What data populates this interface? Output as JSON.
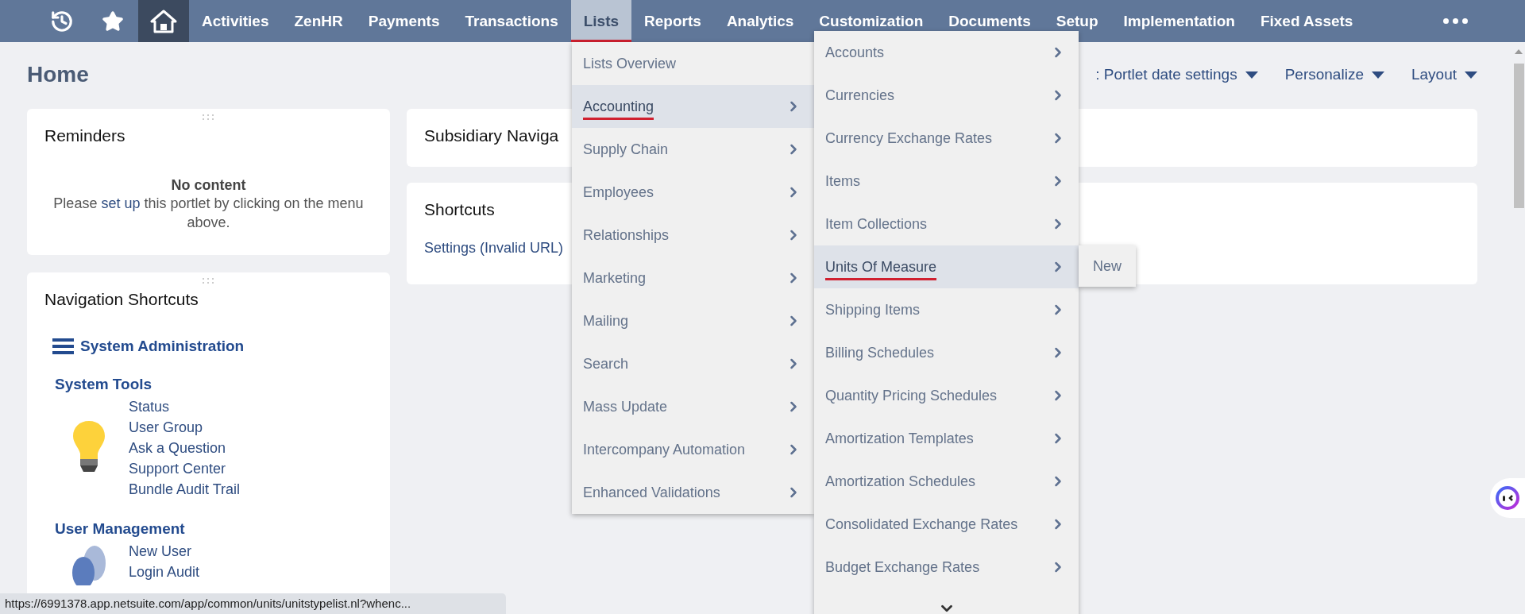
{
  "topbar": {
    "items": [
      {
        "label": "Activities",
        "selected": false
      },
      {
        "label": "ZenHR",
        "selected": false
      },
      {
        "label": "Payments",
        "selected": false
      },
      {
        "label": "Transactions",
        "selected": false
      },
      {
        "label": "Lists",
        "selected": true
      },
      {
        "label": "Reports",
        "selected": false
      },
      {
        "label": "Analytics",
        "selected": false
      },
      {
        "label": "Customization",
        "selected": false
      },
      {
        "label": "Documents",
        "selected": false
      },
      {
        "label": "Setup",
        "selected": false
      },
      {
        "label": "Implementation",
        "selected": false
      },
      {
        "label": "Fixed Assets",
        "selected": false
      }
    ]
  },
  "page": {
    "title": "Home",
    "toolbar": [
      ": Portlet date settings",
      "Personalize",
      "Layout"
    ]
  },
  "reminders": {
    "title": "Reminders",
    "empty_title": "No content",
    "message_before": "Please",
    "link": "set up",
    "message_after": "this portlet by clicking on the menu above."
  },
  "navigation_shortcuts": {
    "title": "Navigation Shortcuts",
    "header": "System Administration",
    "groups": [
      {
        "title": "System Tools",
        "kind": "bulb",
        "links": [
          "Status",
          "User Group",
          "Ask a Question",
          "Support Center",
          "Bundle Audit Trail"
        ]
      },
      {
        "title": "User Management",
        "kind": "users",
        "links": [
          "New User",
          "Login Audit"
        ]
      }
    ]
  },
  "subsidiary": {
    "title": "Subsidiary Naviga"
  },
  "shortcuts": {
    "title": "Shortcuts",
    "links": [
      "Settings (Invalid URL)"
    ]
  },
  "lists_menu": {
    "items": [
      {
        "label": "Lists Overview",
        "selected": false,
        "has_submenu": false
      },
      {
        "label": "Accounting",
        "selected": true,
        "has_submenu": true
      },
      {
        "label": "Supply Chain",
        "selected": false,
        "has_submenu": true
      },
      {
        "label": "Employees",
        "selected": false,
        "has_submenu": true
      },
      {
        "label": "Relationships",
        "selected": false,
        "has_submenu": true
      },
      {
        "label": "Marketing",
        "selected": false,
        "has_submenu": true
      },
      {
        "label": "Mailing",
        "selected": false,
        "has_submenu": true
      },
      {
        "label": "Search",
        "selected": false,
        "has_submenu": true
      },
      {
        "label": "Mass Update",
        "selected": false,
        "has_submenu": true
      },
      {
        "label": "Intercompany Automation",
        "selected": false,
        "has_submenu": true
      },
      {
        "label": "Enhanced Validations",
        "selected": false,
        "has_submenu": true
      }
    ]
  },
  "accounting_menu": {
    "items": [
      {
        "label": "Accounts",
        "selected": false,
        "has_submenu": true
      },
      {
        "label": "Currencies",
        "selected": false,
        "has_submenu": true
      },
      {
        "label": "Currency Exchange Rates",
        "selected": false,
        "has_submenu": true
      },
      {
        "label": "Items",
        "selected": false,
        "has_submenu": true
      },
      {
        "label": "Item Collections",
        "selected": false,
        "has_submenu": true
      },
      {
        "label": "Units Of Measure",
        "selected": true,
        "has_submenu": true
      },
      {
        "label": "Shipping Items",
        "selected": false,
        "has_submenu": true
      },
      {
        "label": "Billing Schedules",
        "selected": false,
        "has_submenu": true
      },
      {
        "label": "Quantity Pricing Schedules",
        "selected": false,
        "has_submenu": true
      },
      {
        "label": "Amortization Templates",
        "selected": false,
        "has_submenu": true
      },
      {
        "label": "Amortization Schedules",
        "selected": false,
        "has_submenu": true
      },
      {
        "label": "Consolidated Exchange Rates",
        "selected": false,
        "has_submenu": true
      },
      {
        "label": "Budget Exchange Rates",
        "selected": false,
        "has_submenu": true
      }
    ]
  },
  "units_submenu": {
    "items": [
      {
        "label": "New"
      }
    ]
  },
  "status_url": "https://6991378.app.netsuite.com/app/common/units/unitstypelist.nl?whenc..."
}
